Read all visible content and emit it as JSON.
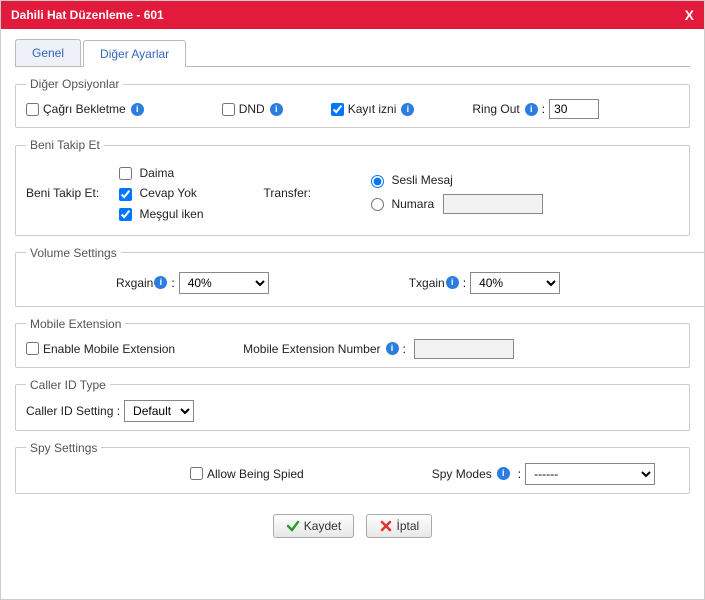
{
  "title": "Dahili Hat Düzenleme - 601",
  "close": "X",
  "tabs": {
    "general": "Genel",
    "other": "Diğer Ayarlar"
  },
  "otherOptions": {
    "legend": "Diğer Opsiyonlar",
    "callWaiting": "Çağrı Bekletme",
    "dnd": "DND",
    "recPerm": "Kayıt izni",
    "ringOut": "Ring Out",
    "ringOutValue": "30"
  },
  "followMe": {
    "legend": "Beni Takip Et",
    "label": "Beni Takip Et:",
    "always": "Daima",
    "noAnswer": "Cevap Yok",
    "busy": "Meşgul iken",
    "transfer": "Transfer:",
    "voicemail": "Sesli Mesaj",
    "number": "Numara",
    "numberValue": ""
  },
  "volume": {
    "legend": "Volume Settings",
    "rxgain": "Rxgain",
    "rxvalue": "40%",
    "txgain": "Txgain",
    "txvalue": "40%"
  },
  "mobile": {
    "legend": "Mobile Extension",
    "enable": "Enable Mobile Extension",
    "numberLabel": "Mobile Extension Number",
    "numberValue": ""
  },
  "callerId": {
    "legend": "Caller ID Type",
    "setting": "Caller ID Setting :",
    "value": "Default"
  },
  "spy": {
    "legend": "Spy Settings",
    "allow": "Allow Being Spied",
    "modes": "Spy Modes",
    "value": "------"
  },
  "buttons": {
    "save": "Kaydet",
    "cancel": "İptal"
  },
  "colon": ":"
}
